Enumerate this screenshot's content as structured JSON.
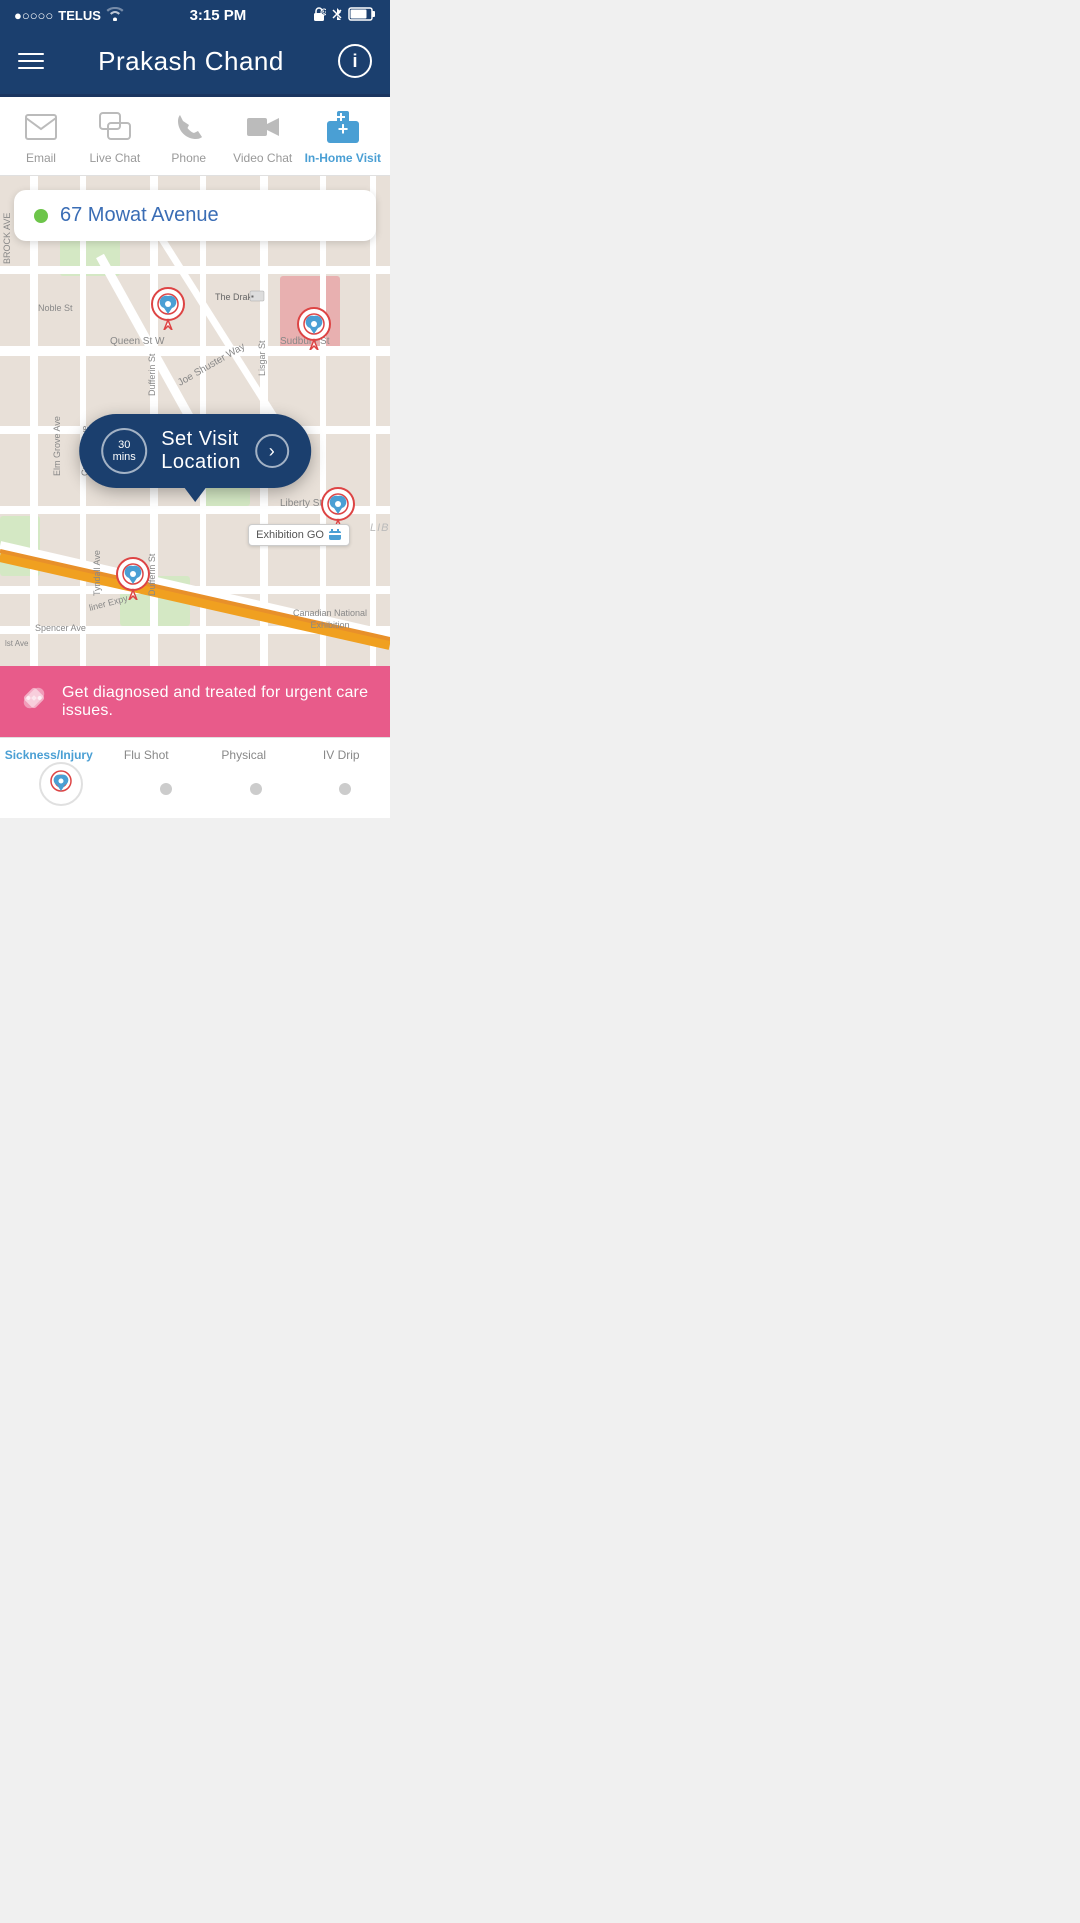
{
  "statusBar": {
    "carrier": "TELUS",
    "time": "3:15 PM",
    "signal": "●○○○○",
    "wifi": true,
    "battery": "75%"
  },
  "header": {
    "title": "Prakash Chand",
    "menuLabel": "menu",
    "infoLabel": "i"
  },
  "navIcons": [
    {
      "id": "email",
      "label": "Email",
      "active": false
    },
    {
      "id": "live-chat",
      "label": "Live Chat",
      "active": false
    },
    {
      "id": "phone",
      "label": "Phone",
      "active": false
    },
    {
      "id": "video-chat",
      "label": "Video Chat",
      "active": false
    },
    {
      "id": "in-home-visit",
      "label": "In-Home Visit",
      "active": true
    }
  ],
  "map": {
    "address": "67 Mowat Avenue",
    "addressDotColor": "#6dc54a",
    "ctaLabel": "Set Visit Location",
    "ctaBadgeTop": "30",
    "ctaBadgeBottom": "mins",
    "exhibitionLabel": "Exhibition GO"
  },
  "banner": {
    "text": "Get diagnosed and treated for urgent care issues.",
    "icon": "bandage"
  },
  "bottomNav": {
    "tabs": [
      {
        "label": "Sickness/Injury",
        "active": true
      },
      {
        "label": "Flu Shot",
        "active": false
      },
      {
        "label": "Physical",
        "active": false
      },
      {
        "label": "IV Drip",
        "active": false
      }
    ]
  }
}
